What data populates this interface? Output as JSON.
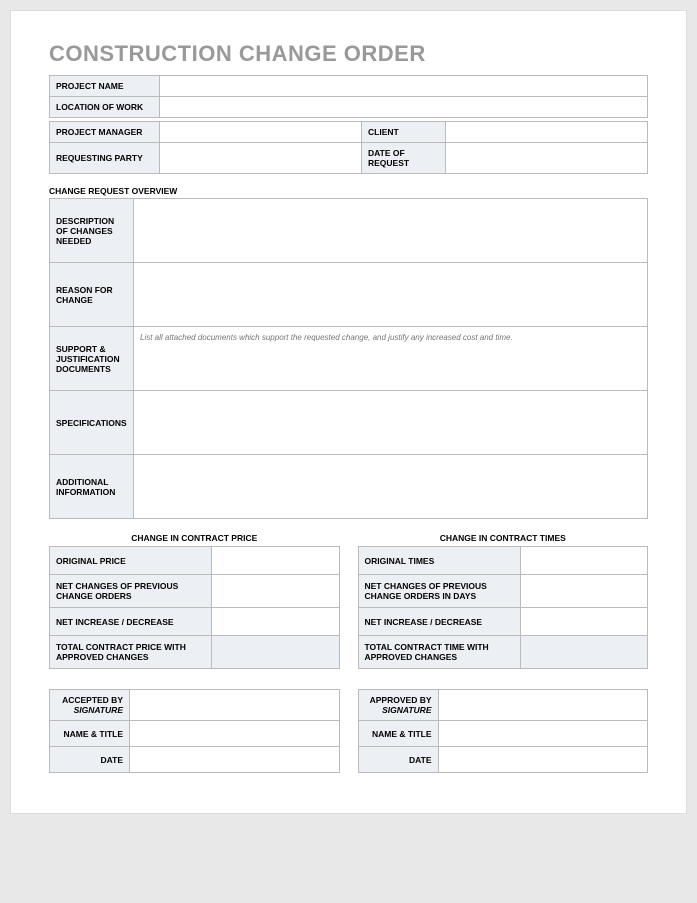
{
  "title": "CONSTRUCTION CHANGE ORDER",
  "info": {
    "projectName": {
      "label": "PROJECT NAME",
      "value": ""
    },
    "locationOfWork": {
      "label": "LOCATION OF WORK",
      "value": ""
    },
    "projectManager": {
      "label": "PROJECT MANAGER",
      "value": ""
    },
    "client": {
      "label": "CLIENT",
      "value": ""
    },
    "requestingParty": {
      "label": "REQUESTING PARTY",
      "value": ""
    },
    "dateOfRequest": {
      "label": "DATE OF REQUEST",
      "value": ""
    }
  },
  "overview": {
    "heading": "CHANGE REQUEST OVERVIEW",
    "description": {
      "label": "DESCRIPTION OF CHANGES NEEDED",
      "value": ""
    },
    "reason": {
      "label": "REASON FOR CHANGE",
      "value": ""
    },
    "support": {
      "label": "SUPPORT & JUSTIFICATION DOCUMENTS",
      "hint": "List all attached documents which support the requested change, and justify any increased cost and time.",
      "value": ""
    },
    "specifications": {
      "label": "SPECIFICATIONS",
      "value": ""
    },
    "additional": {
      "label": "ADDITIONAL INFORMATION",
      "value": ""
    }
  },
  "price": {
    "heading": "CHANGE IN CONTRACT PRICE",
    "original": {
      "label": "ORIGINAL PRICE",
      "value": ""
    },
    "netChanges": {
      "label": "NET CHANGES OF PREVIOUS CHANGE ORDERS",
      "value": ""
    },
    "netIncDec": {
      "label": "NET INCREASE / DECREASE",
      "value": ""
    },
    "total": {
      "label": "TOTAL CONTRACT PRICE WITH APPROVED CHANGES",
      "value": ""
    }
  },
  "times": {
    "heading": "CHANGE IN CONTRACT TIMES",
    "original": {
      "label": "ORIGINAL TIMES",
      "value": ""
    },
    "netChanges": {
      "label": "NET CHANGES OF PREVIOUS CHANGE ORDERS IN DAYS",
      "value": ""
    },
    "netIncDec": {
      "label": "NET INCREASE / DECREASE",
      "value": ""
    },
    "total": {
      "label": "TOTAL CONTRACT TIME WITH APPROVED CHANGES",
      "value": ""
    }
  },
  "accepted": {
    "byMain": "ACCEPTED BY",
    "bySub": "SIGNATURE",
    "nameTitle": {
      "label": "NAME & TITLE",
      "value": ""
    },
    "date": {
      "label": "DATE",
      "value": ""
    },
    "sigValue": ""
  },
  "approved": {
    "byMain": "APPROVED BY",
    "bySub": "SIGNATURE",
    "nameTitle": {
      "label": "NAME & TITLE",
      "value": ""
    },
    "date": {
      "label": "DATE",
      "value": ""
    },
    "sigValue": ""
  }
}
